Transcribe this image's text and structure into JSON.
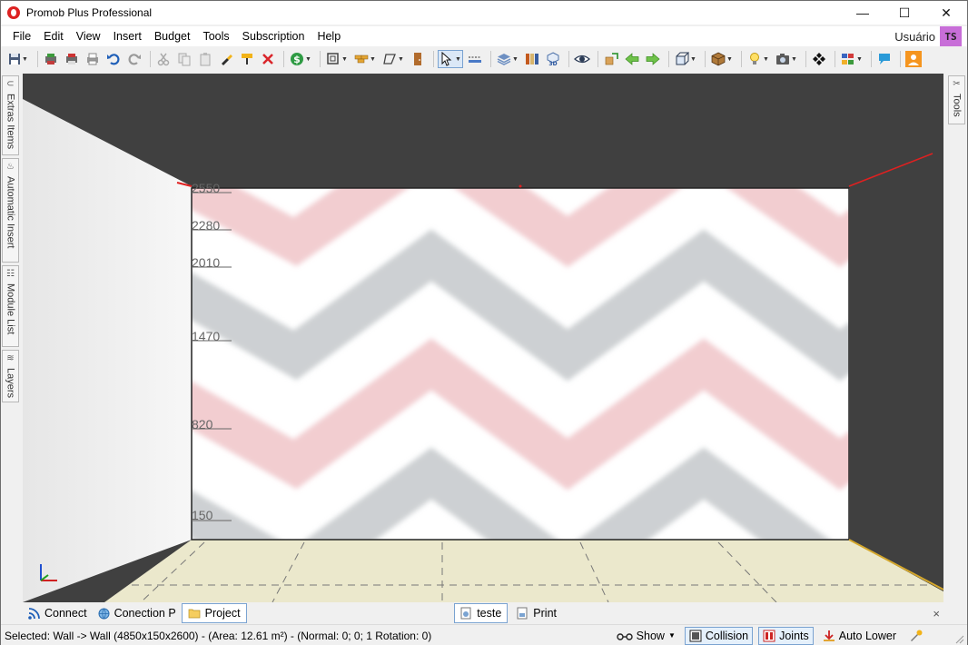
{
  "window": {
    "title": "Promob Plus Professional"
  },
  "menu": [
    "File",
    "Edit",
    "View",
    "Insert",
    "Budget",
    "Tools",
    "Subscription",
    "Help"
  ],
  "user": {
    "name": "Usuário",
    "initials": "TS"
  },
  "left_tabs": [
    "Extras Items",
    "Automatic Insert",
    "Module List",
    "Layers"
  ],
  "right_tabs": [
    "Tools"
  ],
  "viewport": {
    "wall_dimension_marks": [
      "2550",
      "2280",
      "2010",
      "1470",
      "820",
      "150"
    ],
    "wall_color_stripes": [
      "#f2cdd0",
      "#cdd0d3"
    ],
    "floor_color": "#ebe8cc",
    "background_color": "#404040"
  },
  "bottom_tabs": {
    "left": [
      "Connect",
      "Conection P",
      "Project"
    ],
    "right": [
      "teste",
      "Print"
    ],
    "close": "×"
  },
  "status": {
    "text": "Selected: Wall -> Wall (4850x150x2600) - (Area: 12.61 m²) - (Normal: 0; 0; 1 Rotation: 0)",
    "show": "Show",
    "collision": "Collision",
    "joints": "Joints",
    "auto_lower": "Auto Lower"
  },
  "window_controls": {
    "minimize": "—",
    "maximize": "☐",
    "close": "✕"
  }
}
